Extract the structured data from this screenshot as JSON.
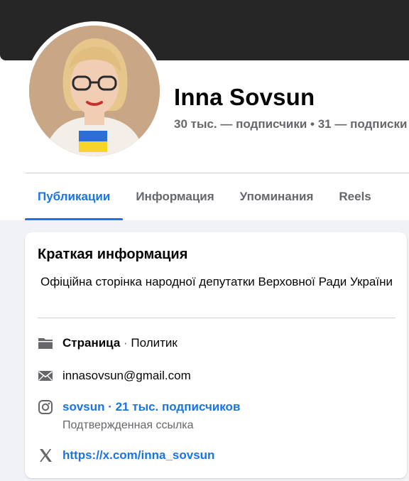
{
  "profile": {
    "name": "Inna Sovsun",
    "stats": "30 тыс. — подписчики • 31 — подписки"
  },
  "tabs": [
    {
      "label": "Публикации",
      "active": true
    },
    {
      "label": "Информация",
      "active": false
    },
    {
      "label": "Упоминания",
      "active": false
    },
    {
      "label": "Reels",
      "active": false
    }
  ],
  "intro_card": {
    "title": "Краткая информация",
    "bio": "Офіційна сторінка народної депутатки Верховної Ради України",
    "page_type_label": "Страница",
    "page_type_sep": " · ",
    "category": "Политик",
    "email": "innasovsun@gmail.com",
    "instagram": {
      "link": "sovsun · 21 тыс. подписчиков",
      "note": "Подтвержденная ссылка"
    },
    "x_link": "https://x.com/inna_sovsun"
  },
  "colors": {
    "accent": "#1b74e4",
    "cover": "#262626",
    "muted_text": "#65676b",
    "page_bg": "#f0f2f5"
  },
  "icons": {
    "page": "page-flag-icon",
    "email": "envelope-icon",
    "instagram": "instagram-icon",
    "x": "x-logo-icon"
  }
}
